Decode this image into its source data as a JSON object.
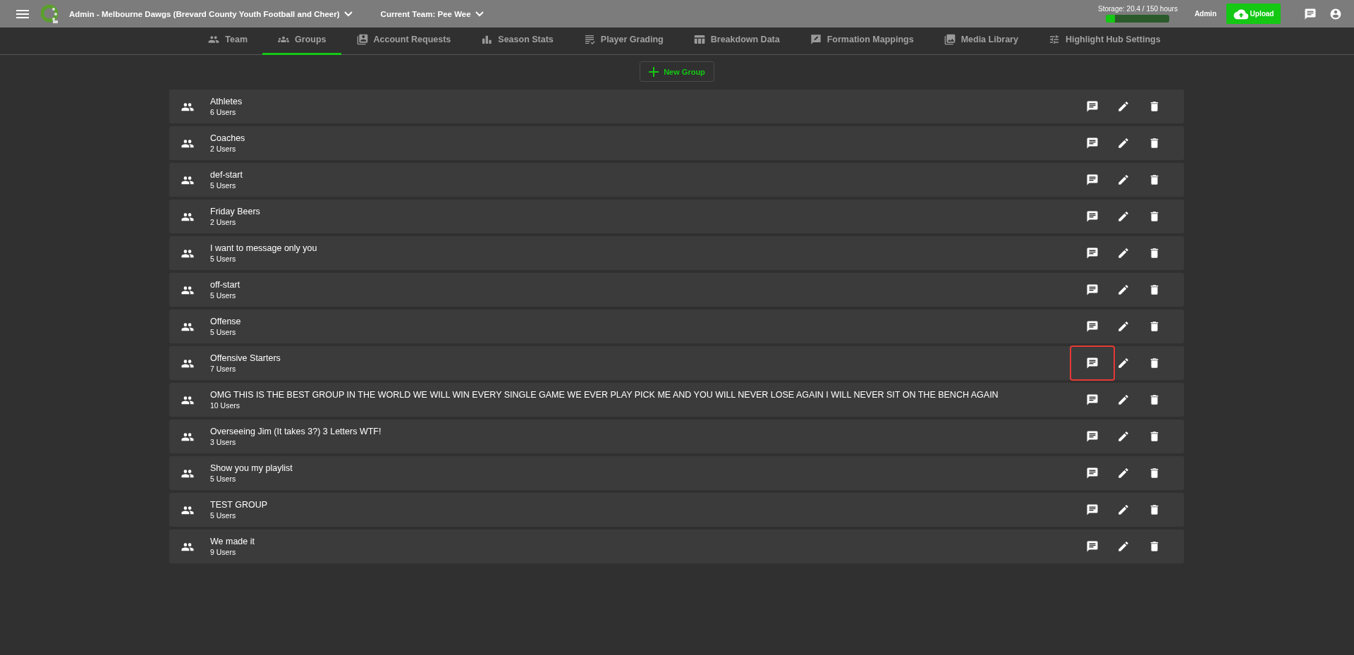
{
  "top_bar": {
    "org": "Admin - Melbourne Dawgs (Brevard County Youth Football and Cheer)",
    "team": "Current Team: Pee Wee",
    "storage": {
      "label": "Storage: 20.4 / 150 hours",
      "level": 0.136
    },
    "role": "Admin",
    "upload": "Upload"
  },
  "tabs": [
    {
      "label": "Team",
      "selected": false
    },
    {
      "label": "Groups",
      "selected": true
    },
    {
      "label": "Account Requests",
      "selected": false
    },
    {
      "label": "Season Stats",
      "selected": false
    },
    {
      "label": "Player Grading",
      "selected": false
    },
    {
      "label": "Breakdown Data",
      "selected": false
    },
    {
      "label": "Formation Mappings",
      "selected": false
    },
    {
      "label": "Media Library",
      "selected": false
    },
    {
      "label": "Highlight Hub Settings",
      "selected": false
    }
  ],
  "new_group_button": "New Group",
  "groups": [
    {
      "name": "Athletes",
      "count": "6 Users",
      "highlighted": false
    },
    {
      "name": "Coaches",
      "count": "2 Users",
      "highlighted": false
    },
    {
      "name": "def-start",
      "count": "5 Users",
      "highlighted": false
    },
    {
      "name": "Friday Beers",
      "count": "2 Users",
      "highlighted": false
    },
    {
      "name": "I want to message only you",
      "count": "5 Users",
      "highlighted": false
    },
    {
      "name": "off-start",
      "count": "5 Users",
      "highlighted": false
    },
    {
      "name": "Offense",
      "count": "5 Users",
      "highlighted": false
    },
    {
      "name": "Offensive Starters",
      "count": "7 Users",
      "highlighted": true
    },
    {
      "name": "OMG THIS IS THE BEST GROUP IN THE WORLD WE WILL WIN EVERY SINGLE GAME WE EVER PLAY PICK ME AND YOU WILL NEVER LOSE AGAIN I WILL NEVER SIT ON THE BENCH AGAIN",
      "count": "10 Users",
      "highlighted": false
    },
    {
      "name": "Overseeing Jim (It takes 3?) 3 Letters WTF!",
      "count": "3 Users",
      "highlighted": false
    },
    {
      "name": "Show you my playlist",
      "count": "5 Users",
      "highlighted": false
    },
    {
      "name": "TEST GROUP",
      "count": "5 Users",
      "highlighted": false
    },
    {
      "name": "We made it",
      "count": "9 Users",
      "highlighted": false
    }
  ]
}
